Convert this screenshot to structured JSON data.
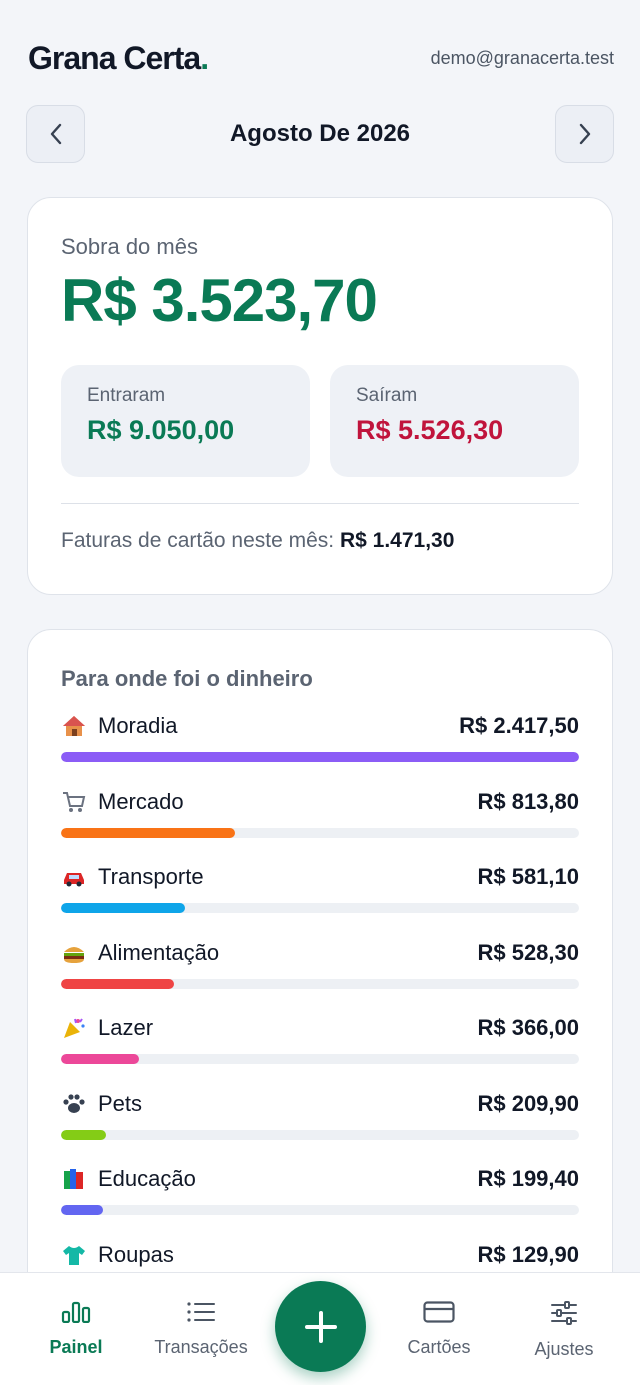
{
  "header": {
    "brand_name": "Grana Certa",
    "brand_dot": ".",
    "email": "demo@granacerta.test"
  },
  "month_nav": {
    "title": "Agosto De 2026"
  },
  "summary": {
    "label": "Sobra do mês",
    "amount": "R$ 3.523,70",
    "income_label": "Entraram",
    "income_value": "R$ 9.050,00",
    "expense_label": "Saíram",
    "expense_value": "R$ 5.526,30",
    "invoice_label": "Faturas de cartão neste mês:",
    "invoice_value": "R$ 1.471,30"
  },
  "categories": {
    "title": "Para onde foi o dinheiro",
    "items": [
      {
        "name": "Moradia",
        "amount": "R$ 2.417,50",
        "icon": "house-icon",
        "color": "#8b5cf6",
        "share": 1.0
      },
      {
        "name": "Mercado",
        "amount": "R$ 813,80",
        "icon": "shopping-cart-icon",
        "color": "#f97316",
        "share": 0.336
      },
      {
        "name": "Transporte",
        "amount": "R$ 581,10",
        "icon": "car-icon",
        "color": "#0ea5e9",
        "share": 0.24
      },
      {
        "name": "Alimentação",
        "amount": "R$ 528,30",
        "icon": "burger-icon",
        "color": "#ef4444",
        "share": 0.218
      },
      {
        "name": "Lazer",
        "amount": "R$ 366,00",
        "icon": "party-popper-icon",
        "color": "#ec4899",
        "share": 0.151
      },
      {
        "name": "Pets",
        "amount": "R$ 209,90",
        "icon": "paw-icon",
        "color": "#84cc16",
        "share": 0.087
      },
      {
        "name": "Educação",
        "amount": "R$ 199,40",
        "icon": "books-icon",
        "color": "#6366f1",
        "share": 0.082
      },
      {
        "name": "Roupas",
        "amount": "R$ 129,90",
        "icon": "shirt-icon",
        "color": "#14b8a6",
        "share": 0.054
      }
    ]
  },
  "bottom_nav": {
    "items": [
      {
        "label": "Painel",
        "icon": "bar-chart-icon",
        "active": true
      },
      {
        "label": "Transações",
        "icon": "list-icon",
        "active": false
      },
      {
        "label": "Cartões",
        "icon": "credit-card-icon",
        "active": false
      },
      {
        "label": "Ajustes",
        "icon": "sliders-icon",
        "active": false
      }
    ],
    "fab_icon": "plus-icon"
  },
  "colors": {
    "brand_green": "#0a7a55",
    "expense_red": "#c0143c",
    "background": "#f3f5f9"
  }
}
